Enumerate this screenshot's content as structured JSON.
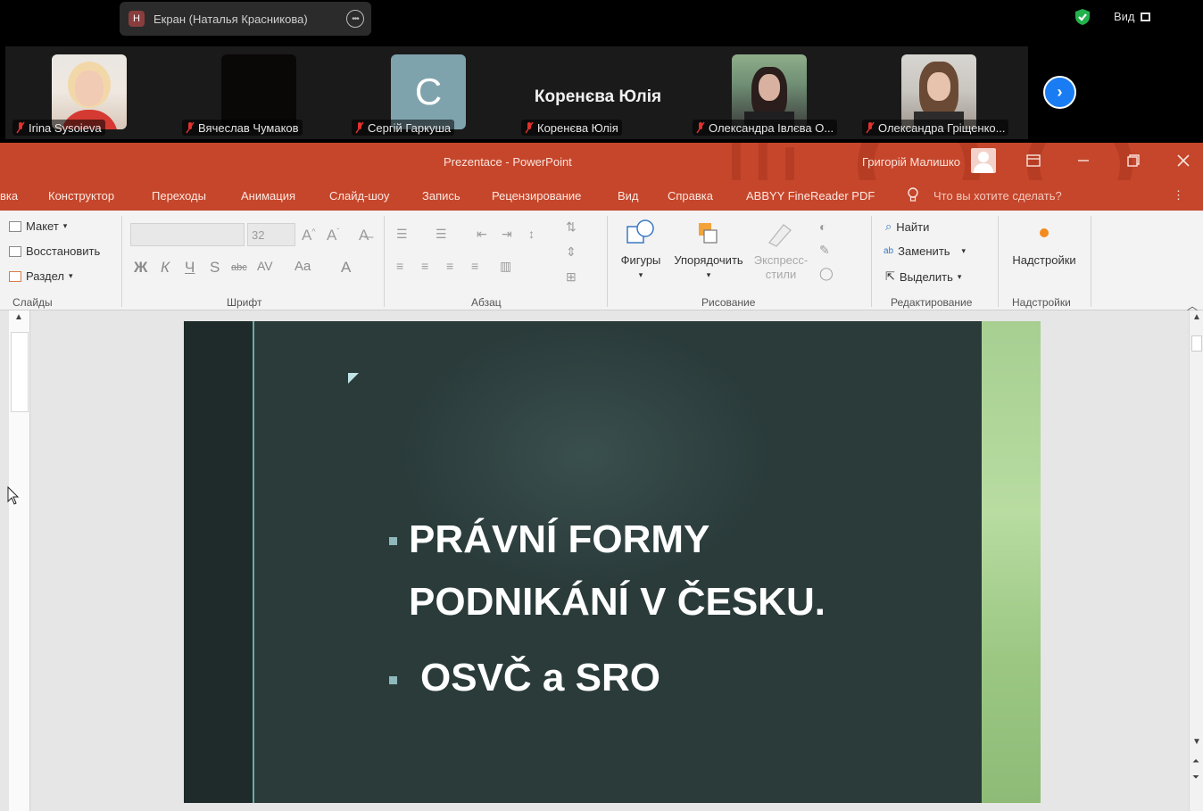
{
  "zoom": {
    "share_label": "Екран (Наталья Красникова)",
    "share_initial": "Н",
    "view_label": "Вид",
    "participants": [
      {
        "name": "Irina Sysoieva",
        "type": "video"
      },
      {
        "name": "Вячеслав Чумаков",
        "type": "video-off"
      },
      {
        "name": "Сергій Гаркуша",
        "type": "initial",
        "initial": "C"
      },
      {
        "name": "Коренєва Юлія",
        "type": "name-only",
        "display_name": "Коренєва Юлія"
      },
      {
        "name": "Олександра Івлєва О...",
        "type": "video"
      },
      {
        "name": "Олександра Гріщенко...",
        "type": "video"
      }
    ],
    "colors": {
      "initial_tile": "#7fa3ad",
      "next_button": "#1a7cf2",
      "mic_muted": "#e0322f"
    }
  },
  "ppt": {
    "title": "Prezentace  -  PowerPoint",
    "user": "Григорій Малишко",
    "tabs": [
      "вка",
      "Конструктор",
      "Переходы",
      "Анимация",
      "Слайд-шоу",
      "Запись",
      "Рецензирование",
      "Вид",
      "Справка",
      "ABBYY FineReader PDF"
    ],
    "tell_me": "Что вы хотите сделать?",
    "ribbon": {
      "slides_items": [
        "Макет",
        "Восстановить",
        "Раздел"
      ],
      "slides_label": "Слайды",
      "font_size": "32",
      "font_label": "Шрифт",
      "paragraph_label": "Абзац",
      "shapes_label": "Фигуры",
      "arrange_label": "Упорядочить",
      "quick_styles_label": "Экспресс-стили",
      "drawing_label": "Рисование",
      "find_label": "Найти",
      "replace_label": "Заменить",
      "select_label": "Выделить",
      "editing_label": "Редактирование",
      "addins_button": "Надстройки",
      "addins_label": "Надстройки"
    },
    "colors": {
      "titlebar": "#c5462b",
      "slide_bg": "#2a3b3a"
    }
  },
  "slide": {
    "bullet1_line1": "PRÁVNÍ FORMY",
    "bullet1_line2": "PODNIKÁNÍ V ČESKU.",
    "bullet2": "OSVČ a SRO"
  }
}
